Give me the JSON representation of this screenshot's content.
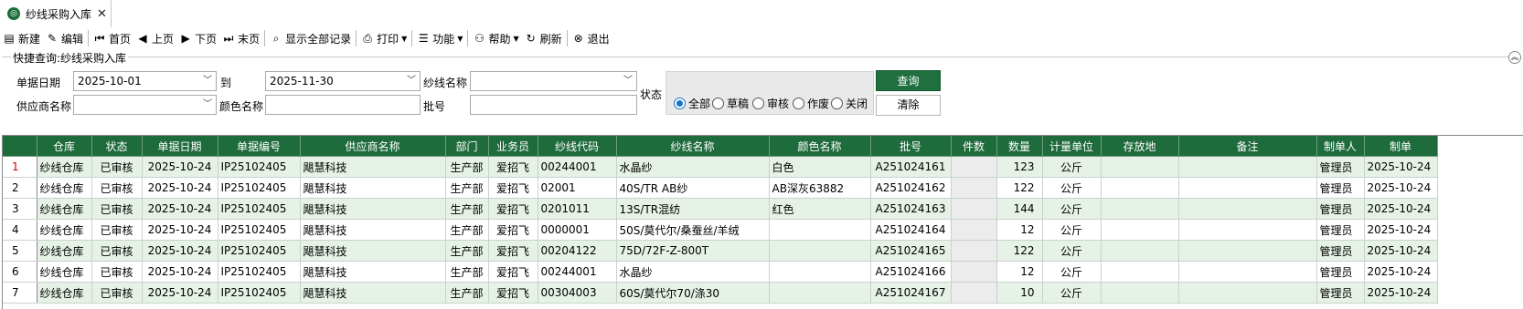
{
  "tab": {
    "title": "纱线采购入库",
    "close": "✕",
    "icon": "app-icon"
  },
  "toolbar": [
    {
      "name": "new",
      "label": "新建",
      "icon": "▤"
    },
    {
      "name": "edit",
      "label": "编辑",
      "icon": "✎"
    },
    {
      "sep": true
    },
    {
      "name": "first",
      "label": "首页",
      "icon": "⏮"
    },
    {
      "name": "prev",
      "label": "上页",
      "icon": "◀"
    },
    {
      "name": "next",
      "label": "下页",
      "icon": "▶"
    },
    {
      "name": "last",
      "label": "末页",
      "icon": "⏭"
    },
    {
      "sep": true
    },
    {
      "name": "show-all",
      "label": "显示全部记录",
      "icon": "⌕"
    },
    {
      "sep": true
    },
    {
      "name": "print",
      "label": "打印",
      "icon": "⎙",
      "dropdown": true
    },
    {
      "sep": true
    },
    {
      "name": "function",
      "label": "功能",
      "icon": "☰",
      "dropdown": true
    },
    {
      "sep": true
    },
    {
      "name": "help",
      "label": "帮助",
      "icon": "⚇",
      "dropdown": true
    },
    {
      "name": "refresh",
      "label": "刷新",
      "icon": "↻"
    },
    {
      "sep": true
    },
    {
      "name": "exit",
      "label": "退出",
      "icon": "⊗"
    }
  ],
  "query": {
    "title": "快捷查询:纱线采购入库",
    "date_label": "单据日期",
    "date_from": "2025-10-01",
    "to_label": "到",
    "date_to": "2025-11-30",
    "yarn_name_label": "纱线名称",
    "yarn_name_value": "",
    "status_label": "状态",
    "supplier_label": "供应商名称",
    "supplier_value": "",
    "color_label": "颜色名称",
    "color_value": "",
    "batch_label": "批号",
    "batch_value": "",
    "status_options": [
      {
        "label": "全部",
        "selected": true
      },
      {
        "label": "草稿",
        "selected": false
      },
      {
        "label": "审核",
        "selected": false
      },
      {
        "label": "作废",
        "selected": false
      },
      {
        "label": "关闭",
        "selected": false
      }
    ],
    "query_button": "查询",
    "clear_button": "清除"
  },
  "grid": {
    "columns": [
      "",
      "仓库",
      "状态",
      "单据日期",
      "单据编号",
      "供应商名称",
      "部门",
      "业务员",
      "纱线代码",
      "纱线名称",
      "颜色名称",
      "批号",
      "件数",
      "数量",
      "计量单位",
      "存放地",
      "备注",
      "制单人",
      "制单"
    ],
    "rows": [
      [
        "1",
        "纱线仓库",
        "已审核",
        "2025-10-24",
        "IP25102405",
        "飓慧科技",
        "生产部",
        "爱招飞",
        "00244001",
        "水晶纱",
        "白色",
        "A251024161",
        "",
        "123",
        "公斤",
        "",
        "",
        "管理员",
        "2025-10-24"
      ],
      [
        "2",
        "纱线仓库",
        "已审核",
        "2025-10-24",
        "IP25102405",
        "飓慧科技",
        "生产部",
        "爱招飞",
        "02001",
        "40S/TR AB纱",
        "AB深灰63882",
        "A251024162",
        "",
        "122",
        "公斤",
        "",
        "",
        "管理员",
        "2025-10-24"
      ],
      [
        "3",
        "纱线仓库",
        "已审核",
        "2025-10-24",
        "IP25102405",
        "飓慧科技",
        "生产部",
        "爱招飞",
        "0201011",
        "13S/TR混纺",
        "红色",
        "A251024163",
        "",
        "144",
        "公斤",
        "",
        "",
        "管理员",
        "2025-10-24"
      ],
      [
        "4",
        "纱线仓库",
        "已审核",
        "2025-10-24",
        "IP25102405",
        "飓慧科技",
        "生产部",
        "爱招飞",
        "0000001",
        "50S/莫代尔/桑蚕丝/羊绒",
        "",
        "A251024164",
        "",
        "12",
        "公斤",
        "",
        "",
        "管理员",
        "2025-10-24"
      ],
      [
        "5",
        "纱线仓库",
        "已审核",
        "2025-10-24",
        "IP25102405",
        "飓慧科技",
        "生产部",
        "爱招飞",
        "00204122",
        "75D/72F-Z-800T",
        "",
        "A251024165",
        "",
        "122",
        "公斤",
        "",
        "",
        "管理员",
        "2025-10-24"
      ],
      [
        "6",
        "纱线仓库",
        "已审核",
        "2025-10-24",
        "IP25102405",
        "飓慧科技",
        "生产部",
        "爱招飞",
        "00244001",
        "水晶纱",
        "",
        "A251024166",
        "",
        "12",
        "公斤",
        "",
        "",
        "管理员",
        "2025-10-24"
      ],
      [
        "7",
        "纱线仓库",
        "已审核",
        "2025-10-24",
        "IP25102405",
        "飓慧科技",
        "生产部",
        "爱招飞",
        "00304003",
        "60S/莫代尔70/涤30",
        "",
        "A251024167",
        "",
        "10",
        "公斤",
        "",
        "",
        "管理员",
        "2025-10-24"
      ]
    ],
    "current_row": 0
  }
}
